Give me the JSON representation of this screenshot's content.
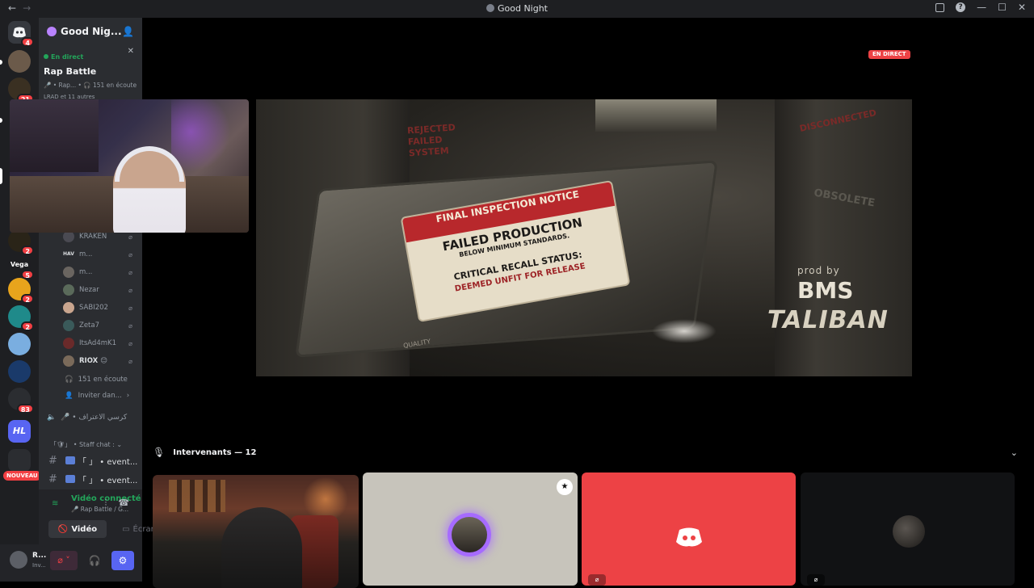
{
  "window": {
    "title": "Good Night",
    "nav_back": "←",
    "nav_forward": "→",
    "controls": {
      "minimize": "—",
      "maximize": "☐",
      "close": "✕"
    }
  },
  "server_rail": {
    "items": [
      {
        "name": "home",
        "badge": "4"
      },
      {
        "name": "server-1",
        "badge": ""
      },
      {
        "name": "server-2",
        "badge": "21"
      },
      {
        "name": "server-3",
        "badge": "2"
      },
      {
        "name": "vega",
        "label": "Vega",
        "badge": "5"
      },
      {
        "name": "server-5",
        "badge": "2"
      },
      {
        "name": "server-6",
        "badge": "2"
      },
      {
        "name": "server-7",
        "badge": ""
      },
      {
        "name": "server-8",
        "badge": ""
      },
      {
        "name": "server-folder",
        "badge": "83"
      },
      {
        "name": "hl",
        "label": "HL",
        "badge": ""
      },
      {
        "name": "folder",
        "badge": ""
      }
    ],
    "new_badge": "NOUVEAU"
  },
  "guild": {
    "name": "Good Nig...",
    "chevron": "⌄"
  },
  "live": {
    "status": "En direct",
    "name": "Rap Battle",
    "sub": "🎤 • Rap... • 🎧 151 en écoute",
    "extra": "LRAD et 11 autres"
  },
  "members": [
    {
      "name": "KRAKEN"
    },
    {
      "name": "m...",
      "prefix": "HAV"
    },
    {
      "name": "m..."
    },
    {
      "name": "Nezar"
    },
    {
      "name": "SABI202"
    },
    {
      "name": "Zeta7"
    },
    {
      "name": "ItsAd4mK1"
    },
    {
      "name": "RIOX",
      "suffix": "😊"
    }
  ],
  "listeners": "151 en écoute",
  "invite": "Inviter dan...",
  "arabic_channel": "🎤 • كرسي الاعتراف",
  "staff_category": "「🛡」 • Staff chat : ⌄",
  "channels": [
    {
      "label": "「  」 • event..."
    },
    {
      "label": "「  」 • event..."
    }
  ],
  "voice": {
    "status": "Vidéo connecté",
    "sub": "🎤 Rap Battle / G...",
    "video_btn": "Vidéo",
    "screen_btn": "Écran"
  },
  "user": {
    "name": "R...",
    "status": "Inv..."
  },
  "stage": {
    "live_badge": "EN DIRECT",
    "speakers_label": "Intervenants — 12"
  },
  "artwork": {
    "sign_title": "FINAL INSPECTION NOTICE",
    "sign_line1": "FAILED PRODUCTION",
    "sign_line2": "BELOW MINIMUM STANDARDS.",
    "sign_line3": "CRITICAL RECALL STATUS:",
    "sign_line4": "DEEMED UNFIT FOR RELEASE",
    "graffiti_rejected": "REJECTED FAILED SYSTEM",
    "graffiti_obsolete": "OBSOLETE",
    "graffiti_disco": "DISCONNECTED",
    "prod_by": "prod by",
    "producer_1": "BMS",
    "producer_2": "TALIBAN",
    "quality": "QUALITY"
  },
  "colors": {
    "rail": "#1e1f22",
    "sidebar": "#2b2d31",
    "accent": "#5865f2",
    "live_red": "#ed4245",
    "green": "#23a55a"
  }
}
